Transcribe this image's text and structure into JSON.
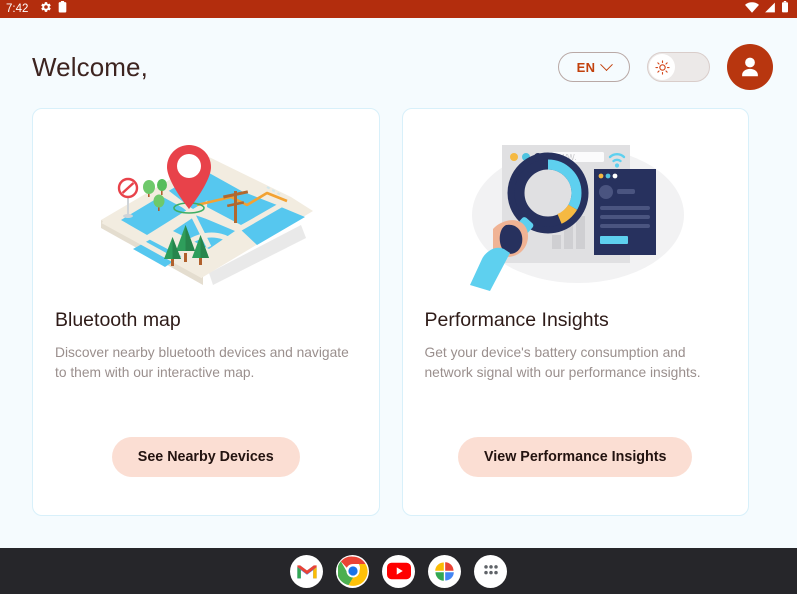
{
  "statusbar": {
    "time": "7:42",
    "left_icons": [
      "android-settings-icon",
      "clipboard-icon"
    ],
    "right_icons": [
      "wifi-icon",
      "cellular-signal-icon",
      "battery-icon"
    ],
    "background": "#b32d0d"
  },
  "header": {
    "greeting": "Welcome,",
    "language": {
      "label": "EN",
      "icon": "chevron-down-icon"
    },
    "theme_toggle": {
      "icon": "sun-icon",
      "state": "light"
    },
    "avatar_icon": "user-avatar-icon"
  },
  "cards": [
    {
      "illustration": "isometric-bluetooth-map-illustration",
      "title": "Bluetooth map",
      "description": "Discover nearby bluetooth devices and navigate to them with our interactive map.",
      "button": "See Nearby Devices"
    },
    {
      "illustration": "performance-analytics-illustration",
      "title": "Performance Insights",
      "description": "Get your device's battery consumption and network signal with our performance insights.",
      "button": "View Performance Insights"
    }
  ],
  "dock": {
    "items": [
      {
        "name": "gmail-icon",
        "label": "Gmail"
      },
      {
        "name": "chrome-icon",
        "label": "Chrome"
      },
      {
        "name": "youtube-icon",
        "label": "YouTube"
      },
      {
        "name": "google-photos-icon",
        "label": "Photos"
      },
      {
        "name": "app-drawer-icon",
        "label": "All apps"
      }
    ]
  },
  "colors": {
    "status_bar": "#b32d0d",
    "accent": "#c2410c",
    "avatar": "#b8360f",
    "button_bg": "#fbded3",
    "page_bg": "#f5fbfe",
    "card_bg": "#ffffff",
    "card_border": "#d8f0fa",
    "dock_bg": "#26262a",
    "title_text": "#2e1b18",
    "muted_text": "#9a8f8d"
  }
}
